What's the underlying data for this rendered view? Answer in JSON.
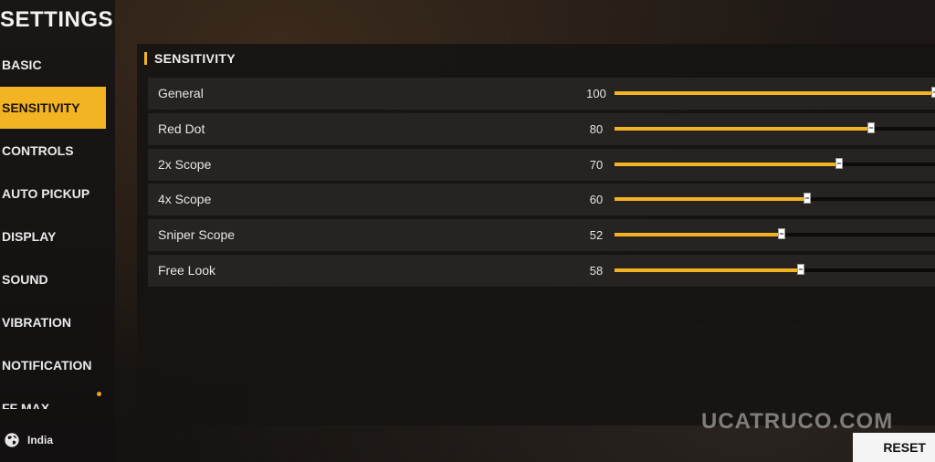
{
  "sidebar": {
    "title": "SETTINGS",
    "items": [
      {
        "label": "BASIC",
        "active": false
      },
      {
        "label": "SENSITIVITY",
        "active": true
      },
      {
        "label": "CONTROLS",
        "active": false
      },
      {
        "label": "AUTO PICKUP",
        "active": false
      },
      {
        "label": "DISPLAY",
        "active": false
      },
      {
        "label": "SOUND",
        "active": false
      },
      {
        "label": "VIBRATION",
        "active": false
      },
      {
        "label": "NOTIFICATION",
        "active": false
      },
      {
        "label": "FF MAX",
        "active": false
      }
    ],
    "region": {
      "label": "India",
      "icon": "globe-icon"
    }
  },
  "section": {
    "title": "SENSITIVITY"
  },
  "sensitivity": [
    {
      "label": "General",
      "value": 100,
      "max": 100
    },
    {
      "label": "Red Dot",
      "value": 80,
      "max": 100
    },
    {
      "label": "2x Scope",
      "value": 70,
      "max": 100
    },
    {
      "label": "4x Scope",
      "value": 60,
      "max": 100
    },
    {
      "label": "Sniper Scope",
      "value": 52,
      "max": 100
    },
    {
      "label": "Free Look",
      "value": 58,
      "max": 100
    }
  ],
  "watermark": "UCATRUCO.COM",
  "actions": {
    "reset_label": "RESET"
  },
  "colors": {
    "accent": "#f2b423",
    "panel": "#161311",
    "row": "#272320"
  }
}
